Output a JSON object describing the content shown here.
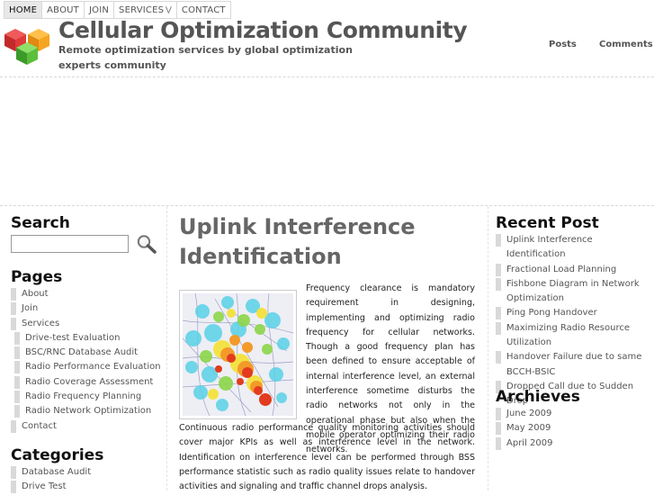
{
  "nav": {
    "items": [
      {
        "label": "HOME",
        "active": true
      },
      {
        "label": "ABOUT",
        "active": false
      },
      {
        "label": "JOIN",
        "active": false
      },
      {
        "label": "SERVICES",
        "active": false,
        "has_dropdown": true
      },
      {
        "label": "CONTACT",
        "active": false
      }
    ]
  },
  "header": {
    "title": "Cellular Optimization Community",
    "tagline": "Remote optimization services by global optimization experts community",
    "links": [
      "Posts",
      "Comments"
    ]
  },
  "sidebar_left": {
    "search_title": "Search",
    "search_value": "",
    "pages_title": "Pages",
    "pages": [
      {
        "label": "About",
        "sub": false
      },
      {
        "label": "Join",
        "sub": false
      },
      {
        "label": "Services",
        "sub": false
      },
      {
        "label": "Drive-test Evaluation",
        "sub": true
      },
      {
        "label": "BSC/RNC Database Audit",
        "sub": true
      },
      {
        "label": "Radio Performance Evaluation",
        "sub": true
      },
      {
        "label": "Radio Coverage Assessment",
        "sub": true
      },
      {
        "label": "Radio Frequency Planning",
        "sub": true
      },
      {
        "label": "Radio Network Optimization",
        "sub": true
      },
      {
        "label": "Contact",
        "sub": false
      }
    ],
    "categories_title": "Categories",
    "categories": [
      "Database Audit",
      "Drive Test"
    ]
  },
  "main": {
    "post_title": "Uplink Interference Identification",
    "paragraph1": "Frequency clearance is mandatory requirement in designing, implementing and optimizing radio frequency for cellular networks. Though a good frequency plan has been defined to ensure acceptable of internal interference level, an external interference sometime disturbs the radio networks not only in the operational phase but also when the mobile operator optimizing their radio networks.",
    "paragraph2": "Continuous radio performance quality monitoring activities should cover major KPIs as well as interference level in the network. Identification on interference level can be performed through BSS performance statistic such as radio quality issues relate to handover activities and signaling and traffic channel drops analysis."
  },
  "sidebar_right": {
    "recent_title": "Recent Post",
    "recent": [
      "Uplink Interference Identification",
      "Fractional Load Planning",
      "Fishbone Diagram in Network Optimization",
      "Ping Pong Handover",
      "Maximizing Radio Resource Utilization",
      "Handover Failure due to same BCCH-BSIC",
      "Dropped Call due to Sudden Drop"
    ],
    "archives_title": "Archieves",
    "archives": [
      "June 2009",
      "May 2009",
      "April 2009"
    ]
  },
  "icons": {
    "logo": "colored-cubes-logo",
    "search": "magnifier-icon",
    "dropdown": "double-chevron-down-icon"
  }
}
